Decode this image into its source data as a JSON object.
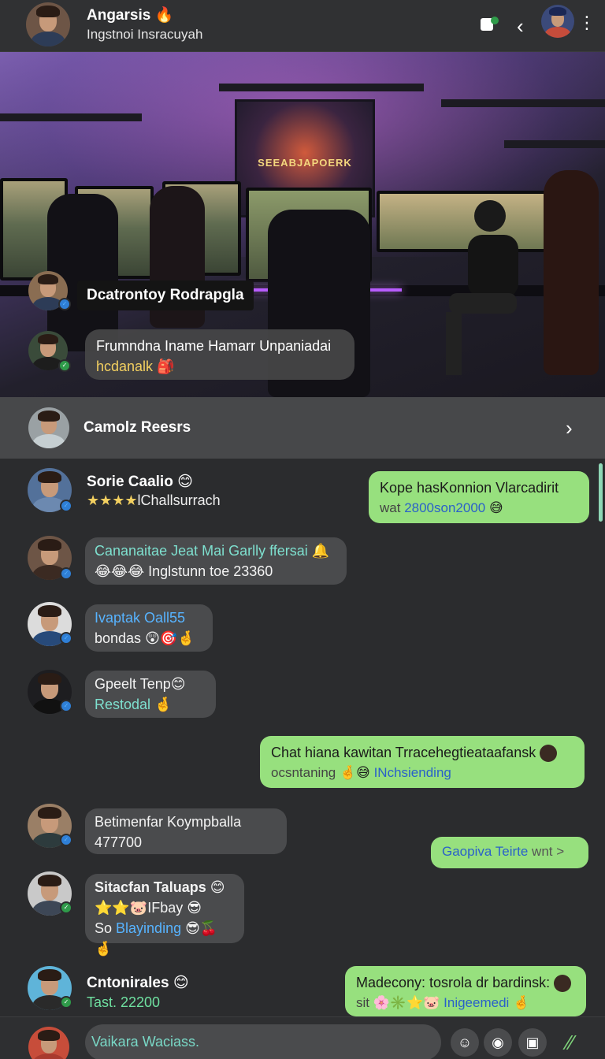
{
  "header": {
    "title": "Angarsis",
    "title_emoji": "🔥",
    "subtitle": "Ingstnoi Insracuyah"
  },
  "hero": {
    "poster_text": "SEEABJAPOERK",
    "overlay_label": "Dcatrontoy Rodrapgla",
    "bubble_line1": "Frumndna Iname Hamarr Unpaniadai",
    "bubble_line2": "hcdanalk",
    "bubble_emoji": "🎒"
  },
  "contact_row": {
    "name": "Camolz Reesrs"
  },
  "messages": [
    {
      "name": "Sorie Caalio",
      "name_emoji": "😊",
      "stars": "★★★★",
      "sub": "lChallsurrach"
    },
    {
      "out_line1": "Kope hasKonnion Vlarcadirit",
      "out_line2_pre": "wat ",
      "out_line2_hl": "2800son2000",
      "out_emoji": "😅"
    },
    {
      "line1": "Cananaitae Jeat Mai Garlly ffersai",
      "line1_emoji": "🔔",
      "line2_emoji": "😂😂😂",
      "line2": "Inglstunn toe 23360"
    },
    {
      "line1": "Ivaptak Oall55",
      "line2": "bondas",
      "line2_emoji": "😲🎯🤞"
    },
    {
      "line1": "Gpeelt Tenp",
      "line1_emoji": "😊",
      "line2": "Restodal",
      "line2_emoji": "🤞"
    },
    {
      "out_line1": "Chat hiana kawitan Trracehegtieataafansk",
      "out_line2_pre": "ocsntaning ",
      "out_emojis": "🤞😅",
      "out_line2_hl": "INchsiending"
    },
    {
      "line1": "Betimenfar Koympballa",
      "line2": "477700"
    },
    {
      "out_text": "Gaopiva Teirte",
      "out_suffix": "wnt >"
    },
    {
      "line1": "Sitacfan Taluaps",
      "line1_emoji": "😊",
      "line2_emoji": "⭐⭐🐷",
      "line2": "IFbay",
      "line2_emoji2": "😎",
      "line3_pre": "So ",
      "line3_hl": "Blayinding",
      "line3_emoji": "😎🍒🤞"
    },
    {
      "name": "Cntonirales",
      "name_emoji": "😊",
      "sub": "Tast. 22200"
    },
    {
      "out_line1": "Madecony: tosrola dr bardinsk:",
      "out_line2_pre": "sit ",
      "out_emojis": "🌸✳️⭐🐷",
      "out_line2_hl": "Inigeemedi",
      "out_emoji2": "🤞"
    }
  ],
  "composer": {
    "placeholder": "Vaikara Waciass."
  }
}
